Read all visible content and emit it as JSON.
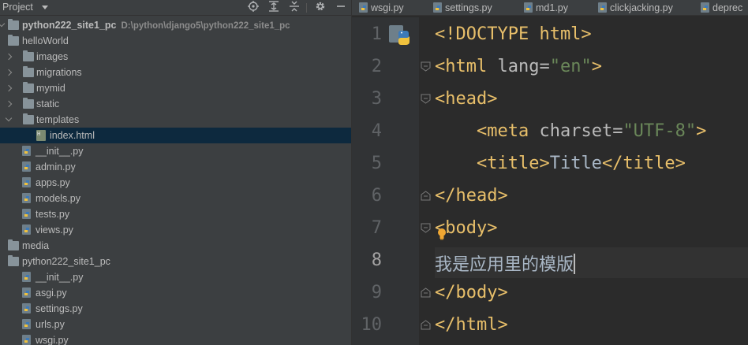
{
  "project_panel": {
    "title": "Project",
    "toolbar_icons": [
      "locate-icon",
      "expand-all-icon",
      "collapse-all-icon",
      "gear-icon",
      "hide-icon"
    ],
    "tree": [
      {
        "label": "python222_site1_pc",
        "path": "D:\\python\\django5\\python222_site1_pc",
        "type": "root-folder",
        "expanded": true
      },
      {
        "label": "helloWorld",
        "type": "folder",
        "expanded": true
      },
      {
        "label": "images",
        "type": "folder",
        "expanded": false
      },
      {
        "label": "migrations",
        "type": "folder",
        "expanded": false
      },
      {
        "label": "mymid",
        "type": "folder",
        "expanded": false
      },
      {
        "label": "static",
        "type": "folder",
        "expanded": false
      },
      {
        "label": "templates",
        "type": "folder",
        "expanded": true
      },
      {
        "label": "index.html",
        "type": "html-file",
        "selected": true
      },
      {
        "label": "__init__.py",
        "type": "python-file"
      },
      {
        "label": "admin.py",
        "type": "python-file"
      },
      {
        "label": "apps.py",
        "type": "python-file"
      },
      {
        "label": "models.py",
        "type": "python-file"
      },
      {
        "label": "tests.py",
        "type": "python-file"
      },
      {
        "label": "views.py",
        "type": "python-file"
      },
      {
        "label": "media",
        "type": "folder"
      },
      {
        "label": "python222_site1_pc",
        "type": "folder"
      },
      {
        "label": "__init__.py",
        "type": "python-file"
      },
      {
        "label": "asgi.py",
        "type": "python-file"
      },
      {
        "label": "settings.py",
        "type": "python-file"
      },
      {
        "label": "urls.py",
        "type": "python-file"
      },
      {
        "label": "wsgi.py",
        "type": "python-file"
      }
    ]
  },
  "editor": {
    "tabs": [
      {
        "label": "wsgi.py"
      },
      {
        "label": "settings.py"
      },
      {
        "label": "md1.py"
      },
      {
        "label": "clickjacking.py"
      },
      {
        "label": "deprec"
      }
    ],
    "line_numbers": [
      "1",
      "2",
      "3",
      "4",
      "5",
      "6",
      "7",
      "8",
      "9",
      "10"
    ],
    "current_line": "8",
    "code": {
      "l1": "<!DOCTYPE html>",
      "l2_open": "<html ",
      "l2_attr": "lang",
      "l2_eq": "=",
      "l2_val": "\"en\"",
      "l2_close": ">",
      "l3": "<head>",
      "l4_indent": "    ",
      "l4_open": "<meta ",
      "l4_attr": "charset",
      "l4_eq": "=",
      "l4_val": "\"UTF-8\"",
      "l4_close": ">",
      "l5_indent": "    ",
      "l5_open": "<title>",
      "l5_text": "Title",
      "l5_close": "</title>",
      "l6": "</head>",
      "l7": "<body>",
      "l8": "我是应用里的模版",
      "l9": "</body>",
      "l10": "</html>"
    },
    "colors": {
      "tag": "#e8bf6a",
      "string": "#6a8759",
      "attr": "#bababa",
      "text": "#a9b7c6",
      "selection": "#0d293e"
    }
  }
}
